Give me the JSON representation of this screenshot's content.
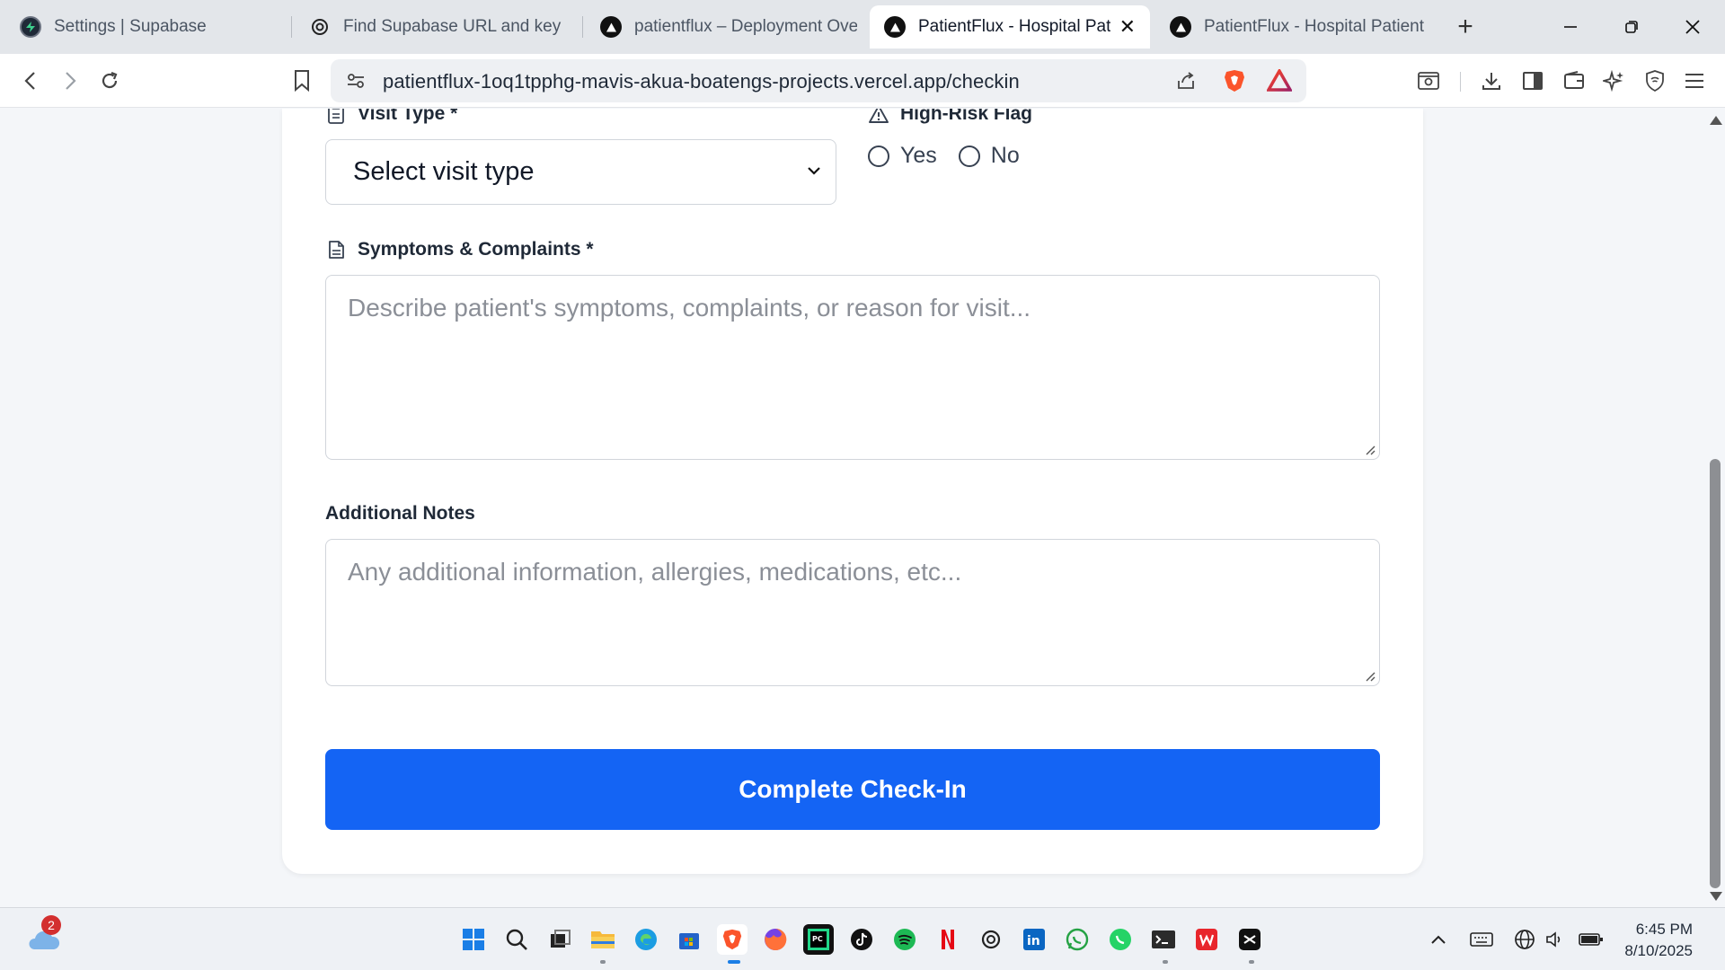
{
  "browser": {
    "tabs": [
      {
        "title": "Settings | Supabase",
        "icon": "supabase-icon"
      },
      {
        "title": "Find Supabase URL and key",
        "icon": "openai-icon"
      },
      {
        "title": "patientflux – Deployment Over",
        "icon": "vercel-icon"
      },
      {
        "title": "PatientFlux - Hospital Patie",
        "icon": "vercel-icon",
        "active": true
      },
      {
        "title": "PatientFlux - Hospital Patient F",
        "icon": "vercel-icon"
      }
    ],
    "url": "patientflux-1oq1tpphg-mavis-akua-boatengs-projects.vercel.app/checkin"
  },
  "form": {
    "visit_type": {
      "label": "Visit Type *",
      "selected": "Select visit type"
    },
    "high_risk": {
      "label": "High-Risk Flag",
      "options": [
        "Yes",
        "No"
      ]
    },
    "symptoms": {
      "label": "Symptoms & Complaints *",
      "placeholder": "Describe patient's symptoms, complaints, or reason for visit..."
    },
    "notes": {
      "label": "Additional Notes",
      "placeholder": "Any additional information, allergies, medications, etc..."
    },
    "submit_label": "Complete Check-In"
  },
  "taskbar": {
    "weather_badge": "2",
    "time": "6:45 PM",
    "date": "8/10/2025"
  },
  "colors": {
    "primary": "#1464f4",
    "border": "#d1d5db"
  }
}
